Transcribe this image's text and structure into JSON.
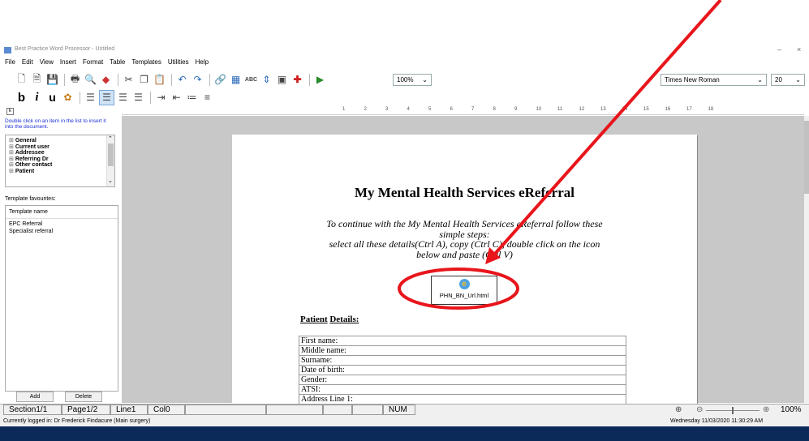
{
  "window": {
    "title": "Best Practice Word Processor - Untitled"
  },
  "menu": [
    "File",
    "Edit",
    "View",
    "Insert",
    "Format",
    "Table",
    "Templates",
    "Utilities",
    "Help"
  ],
  "toolbar": {
    "zoom_value": "100%",
    "font_name": "Times New Roman",
    "font_size": "20",
    "icons": [
      "new-icon",
      "open-icon",
      "save-icon",
      "print-icon",
      "preview-icon",
      "clear-icon",
      "cut-icon",
      "copy-icon",
      "paste-icon",
      "undo-icon",
      "redo-icon",
      "link-icon",
      "table-icon",
      "spellcheck-icon",
      "sort-icon",
      "insert-icon",
      "add-icon",
      "exit-icon"
    ]
  },
  "format_toolbar": {
    "bold": "b",
    "italic": "i",
    "underline": "u"
  },
  "left_panel": {
    "hint": "Double click on an item in the list to insert it into the document.",
    "tree_items": [
      "General",
      "Current user",
      "Addressee",
      "Referring Dr",
      "Other contact",
      "Patient"
    ],
    "favourites_label": "Template favourites:",
    "favourites_header": "Template name",
    "favourites": [
      "EPC Referral",
      "Specialist referral"
    ],
    "add_label": "Add",
    "delete_label": "Delete"
  },
  "document": {
    "title": "My Mental Health Services eReferral",
    "instructions_line1": "To continue with the My Mental Health Services eReferral follow these",
    "instructions_line2": "simple steps:",
    "instructions_line3": "select all these details(Ctrl A), copy (Ctrl C), double click on the  icon",
    "instructions_line4": "below and paste (Ctrl V)",
    "attachment_name": "PHN_BN_Url.html",
    "patient_heading_1": "Patient",
    "patient_heading_2": "Details:",
    "fields": [
      "First name:",
      "Middle name:",
      "Surname:",
      "Date of birth:",
      "Gender:",
      "ATSI:",
      "Address Line 1:"
    ]
  },
  "status": {
    "section": "Section1/1",
    "page": "Page1/2",
    "line": "Line1",
    "col": "Col0",
    "num": "NUM",
    "zoom": "100%"
  },
  "footer": {
    "login": "Currently logged in:  Dr Frederick Findacure (Main surgery)",
    "datetime": "Wednesday 11/03/2020 11:30:29 AM"
  },
  "ruler_numbers": [
    "1",
    "2",
    "3",
    "4",
    "5",
    "6",
    "7",
    "8",
    "9",
    "10",
    "11",
    "12",
    "13",
    "14",
    "15",
    "16",
    "17",
    "18"
  ],
  "colors": {
    "annotation_red": "#e8151b",
    "hint_blue": "#1b2fd6",
    "taskbar": "#0b2a5a"
  }
}
